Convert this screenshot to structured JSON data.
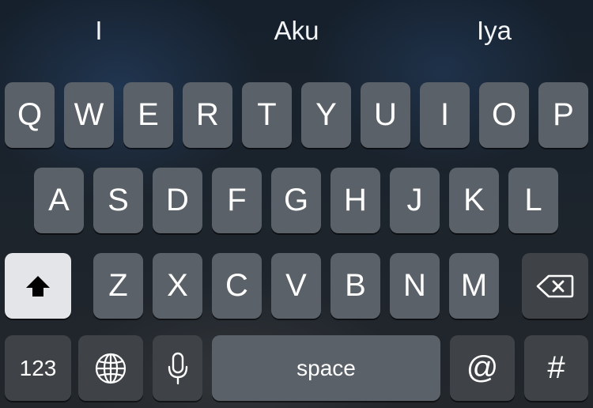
{
  "suggestions": [
    "I",
    "Aku",
    "Iya"
  ],
  "rows": {
    "top": [
      "Q",
      "W",
      "E",
      "R",
      "T",
      "Y",
      "U",
      "I",
      "O",
      "P"
    ],
    "middle": [
      "A",
      "S",
      "D",
      "F",
      "G",
      "H",
      "J",
      "K",
      "L"
    ],
    "bottom": [
      "Z",
      "X",
      "C",
      "V",
      "B",
      "N",
      "M"
    ]
  },
  "bottom_bar": {
    "numbers_label": "123",
    "space_label": "space",
    "at_label": "@",
    "hash_label": "#"
  },
  "icons": {
    "shift": "shift-arrow-icon",
    "backspace": "backspace-icon",
    "globe": "globe-icon",
    "microphone": "microphone-icon"
  },
  "colors": {
    "letter_key": "#5b6168",
    "function_key": "#3f4347",
    "shift_active": "#e3e5e8",
    "key_text": "#ffffff"
  }
}
